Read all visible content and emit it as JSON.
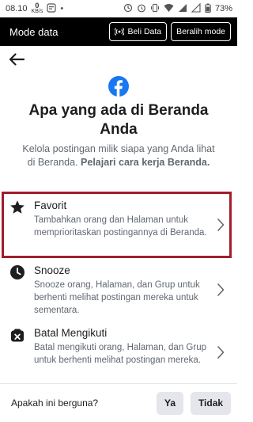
{
  "status_bar": {
    "time": "08.10",
    "speed_value": "0",
    "speed_unit": "KB/s",
    "battery": "73%"
  },
  "mode_bar": {
    "title": "Mode data",
    "buy_data_label": "Beli Data",
    "switch_mode_label": "Beralih mode"
  },
  "header": {
    "title": "Apa yang ada di Beranda Anda",
    "description": "Kelola postingan milik siapa yang Anda lihat di Beranda.",
    "learn_link": "Pelajari cara kerja Beranda."
  },
  "options": [
    {
      "icon": "star-icon",
      "title": "Favorit",
      "text": "Tambahkan orang dan Halaman untuk memprioritaskan postingannya di Beranda."
    },
    {
      "icon": "clock-icon",
      "title": "Snooze",
      "text": "Snooze orang, Halaman, dan Grup untuk berhenti melihat postingan mereka untuk sementara."
    },
    {
      "icon": "unfollow-icon",
      "title": "Batal Mengikuti",
      "text": "Batal mengikuti orang, Halaman, dan Grup untuk berhenti melihat postingan mereka."
    }
  ],
  "feedback": {
    "question": "Apakah ini berguna?",
    "yes_label": "Ya",
    "no_label": "Tidak"
  },
  "colors": {
    "facebook_blue": "#1877f2",
    "highlight_border": "#a11d2b"
  }
}
